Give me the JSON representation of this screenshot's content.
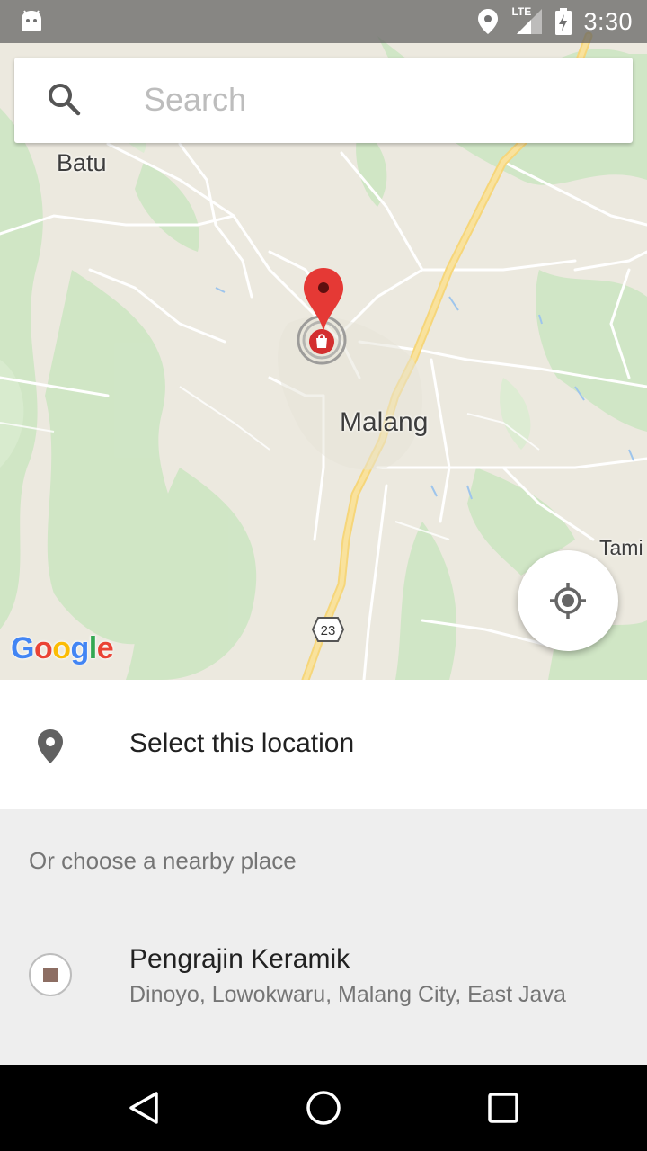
{
  "status_bar": {
    "time": "3:30",
    "network": "LTE",
    "icons": [
      "android-icon",
      "location-icon",
      "signal-icon",
      "battery-charging-icon"
    ]
  },
  "search": {
    "placeholder": "Search",
    "value": ""
  },
  "map": {
    "labels": {
      "batu": "Batu",
      "malang": "Malang",
      "tami": "Tami"
    },
    "road_number": "23",
    "attribution": [
      "G",
      "o",
      "o",
      "g",
      "l",
      "e"
    ],
    "attribution_colors": [
      "#4285F4",
      "#EA4335",
      "#FBBC05",
      "#4285F4",
      "#34A853",
      "#EA4335"
    ],
    "pin_color": "#E53935"
  },
  "select_location": {
    "label": "Select this location",
    "icon": "location-pin-icon"
  },
  "nearby": {
    "heading": "Or choose a nearby place",
    "places": [
      {
        "name": "Pengrajin Keramik",
        "address": "Dinoyo, Lowokwaru, Malang City, East Java"
      }
    ]
  },
  "nav_bar": {
    "buttons": [
      "back-icon",
      "home-icon",
      "recents-icon"
    ]
  }
}
